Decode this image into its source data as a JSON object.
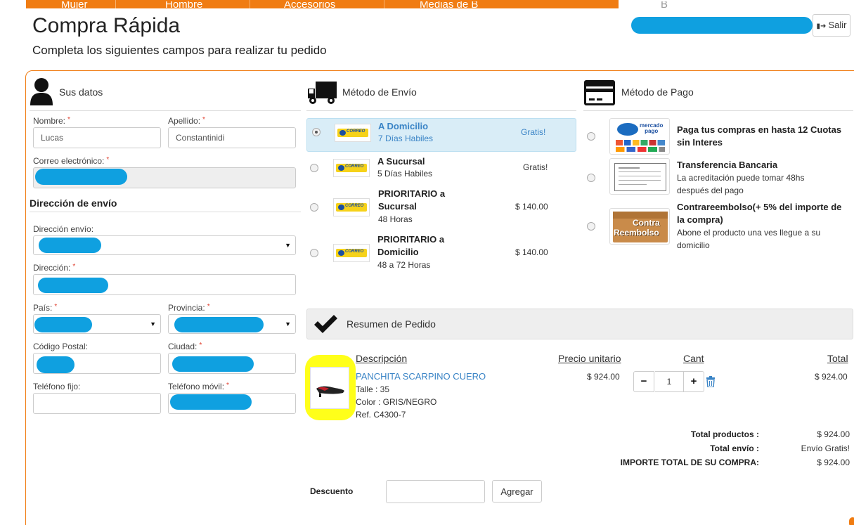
{
  "nav": {
    "tabs": [
      "Mujer",
      "Hombre",
      "Accesorios",
      "Medias de B",
      "B"
    ]
  },
  "header": {
    "title": "Compra Rápida",
    "subtitle": "Completa los siguientes campos para realizar tu pedido",
    "logout_label": "Salir"
  },
  "datos": {
    "heading": "Sus datos",
    "nombre_label": "Nombre:",
    "nombre_value": "Lucas",
    "apellido_label": "Apellido:",
    "apellido_value": "Constantinidi",
    "email_label": "Correo electrónico:",
    "req": "*"
  },
  "direccion": {
    "heading": "Dirección de envío",
    "direccion_envio_label": "Dirección envío:",
    "direccion_label": "Dirección:",
    "pais_label": "País:",
    "provincia_label": "Provincia:",
    "cp_label": "Código Postal:",
    "ciudad_label": "Ciudad:",
    "tel_fijo_label": "Teléfono fijo:",
    "tel_movil_label": "Teléfono móvil:"
  },
  "envio": {
    "heading": "Método de Envío",
    "logo_text": "CORREO",
    "options": [
      {
        "name": "A Domicilio",
        "detail": "7 Días Habiles",
        "price": "Gratis!"
      },
      {
        "name": "A Sucursal",
        "detail": "5 Días Habiles",
        "price": "Gratis!"
      },
      {
        "name_line1": "PRIORITARIO a",
        "name_line2": "Sucursal",
        "detail": "48 Horas",
        "price": "$ 140.00"
      },
      {
        "name_line1": "PRIORITARIO a",
        "name_line2": "Domicilio",
        "detail": "48 a 72 Horas",
        "price": "$ 140.00"
      }
    ]
  },
  "pago": {
    "heading": "Método de Pago",
    "mp_logo_line1": "mercado",
    "mp_logo_line2": "pago",
    "cr_line1": "Contra",
    "cr_line2": "Reembolso",
    "options": [
      {
        "title_line1": "Paga tus compras en hasta 12 Cuotas",
        "title_line2": "sin Interes"
      },
      {
        "title_line1": "Transferencia Bancaria",
        "desc_line1": "La acreditación puede tomar 48hs",
        "desc_line2": "después del pago"
      },
      {
        "title_line1": "Contrareembolso(+ 5% del importe de",
        "title_line2": "la compra)",
        "desc_line1": "Abone el producto una ves llegue a su",
        "desc_line2": "domicilio"
      }
    ]
  },
  "resumen": {
    "heading": "Resumen de Pedido",
    "col_descripcion": "Descripción",
    "col_precio": "Precio unitario",
    "col_cant": "Cant",
    "col_total": "Total",
    "product": {
      "name": "PANCHITA SCARPINO CUERO",
      "talle": "Talle : 35",
      "color": "Color : GRIS/NEGRO",
      "ref": "Ref. C4300-7",
      "unit_price": "$ 924.00",
      "qty": "1",
      "total": "$ 924.00"
    },
    "total_productos_label": "Total productos :",
    "total_productos_value": "$ 924.00",
    "total_envio_label": "Total envío :",
    "total_envio_value": "Envío Gratis!",
    "importe_total_label": "IMPORTE TOTAL DE SU COMPRA:",
    "importe_total_value": "$ 924.00"
  },
  "descuento": {
    "label": "Descuento",
    "button_label": "Agregar"
  },
  "colors": {
    "accent": "#f07c12",
    "link": "#3a84c6",
    "redaction": "#0fa0e0",
    "highlight": "#ffff1a"
  }
}
